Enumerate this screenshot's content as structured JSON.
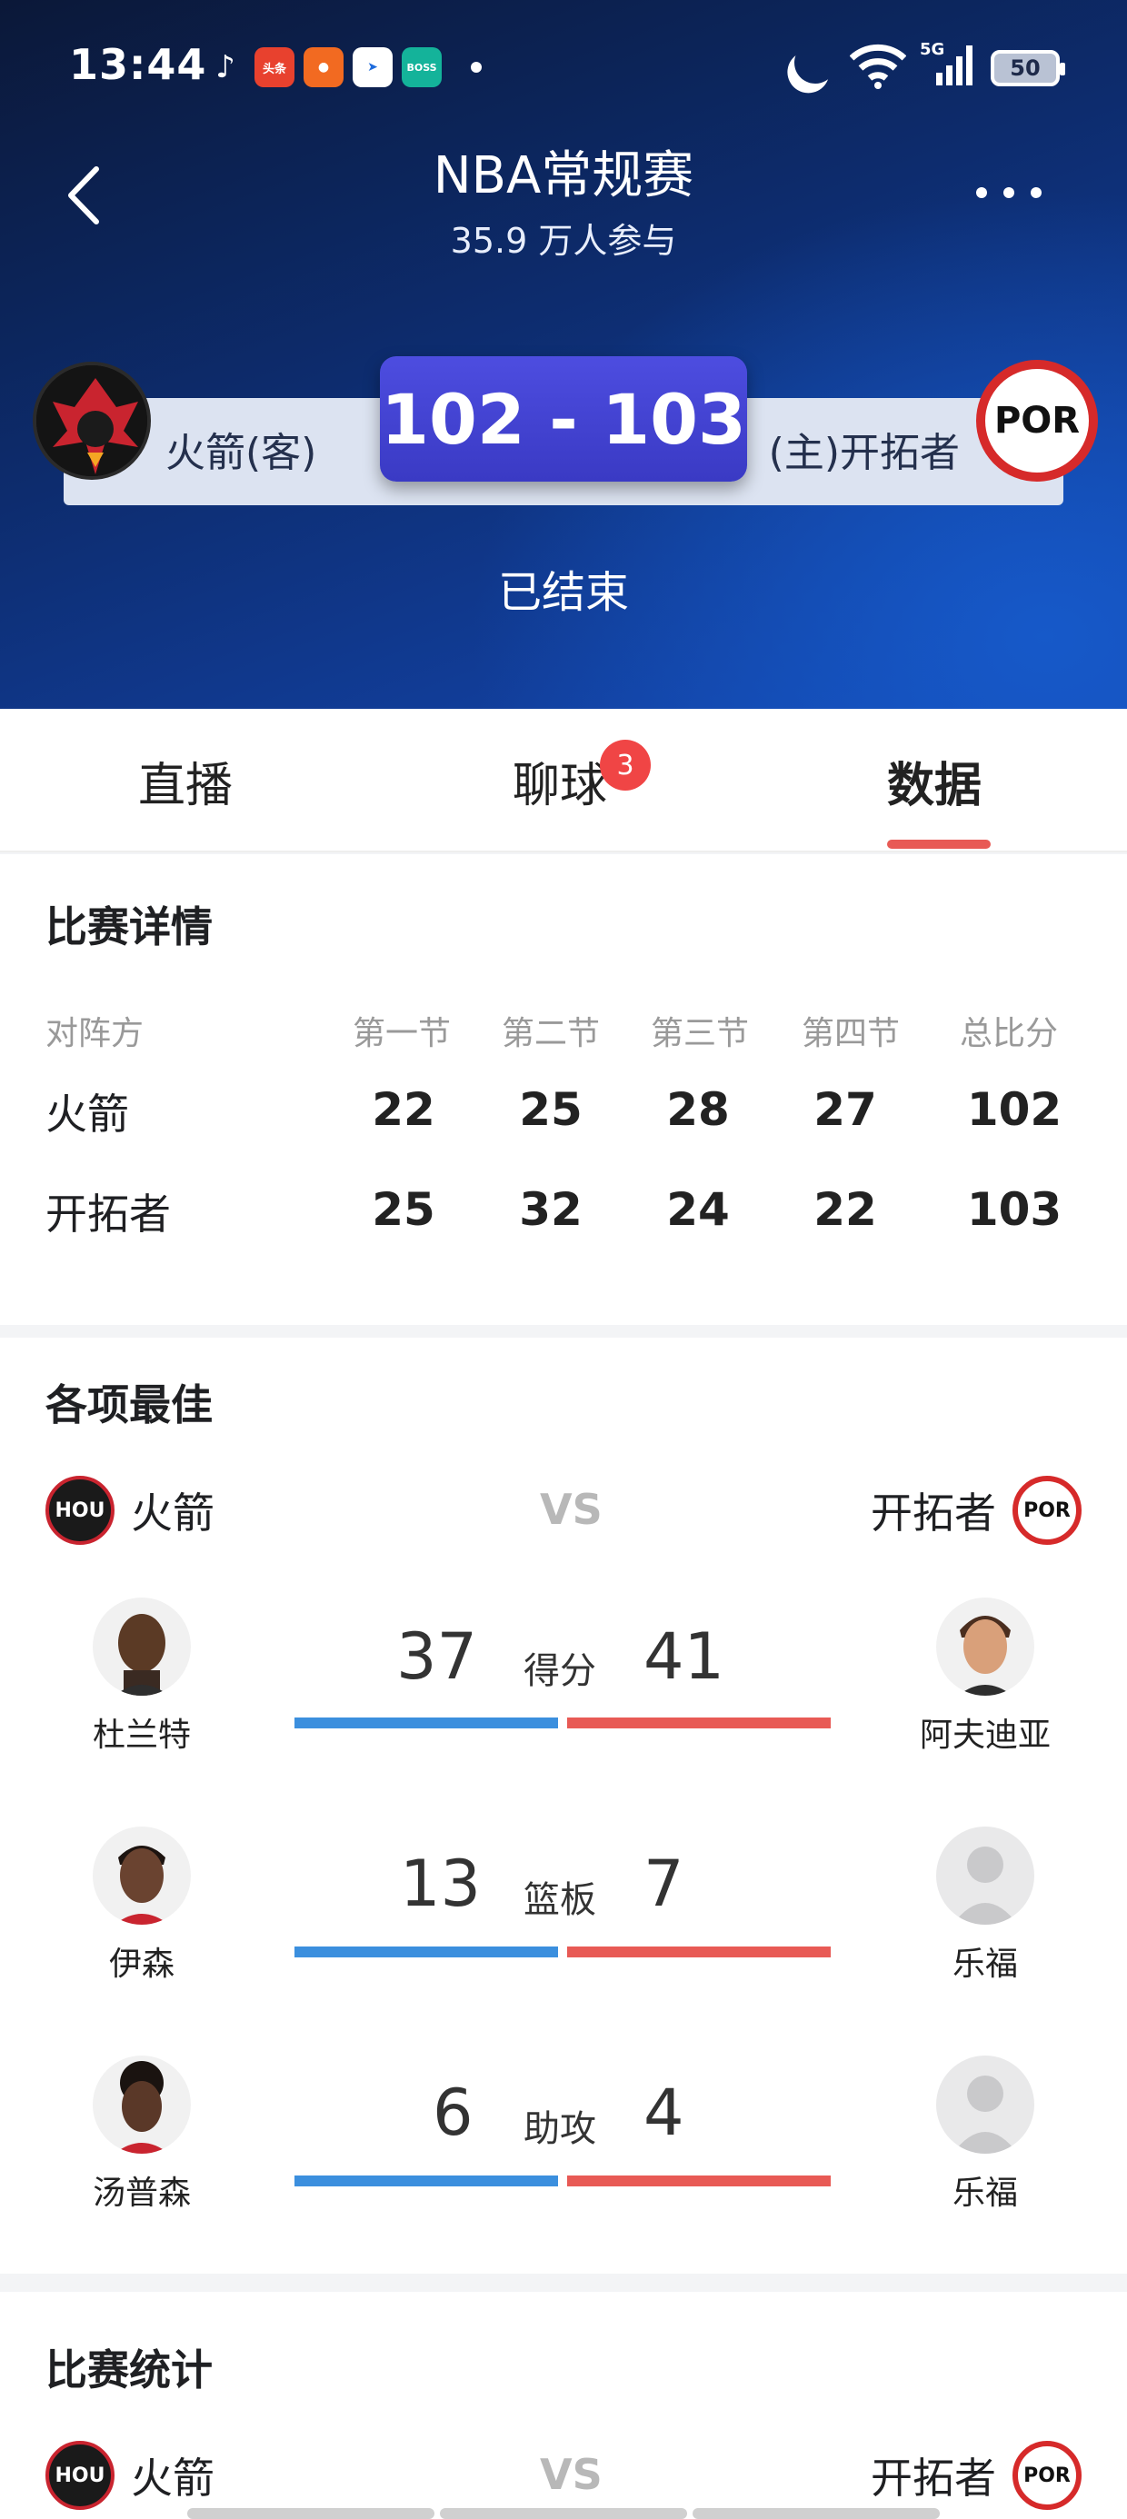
{
  "statusbar": {
    "time": "13:44",
    "apps": [
      "抖音",
      "头条",
      "拼多多",
      "浏览器",
      "BOSS直聘"
    ],
    "network": "5G",
    "battery": "50"
  },
  "header": {
    "title": "NBA常规赛",
    "participants": "35.9 万人参与",
    "away_team": "火箭(客)",
    "home_team": "(主)开拓者",
    "score": "102 - 103",
    "status": "已结束",
    "home_logo_text": "POR"
  },
  "tabs": [
    {
      "label": "直播"
    },
    {
      "label": "聊球",
      "badge": "3"
    },
    {
      "label": "数据",
      "active": true
    }
  ],
  "match_details": {
    "title": "比赛详情",
    "headers": [
      "对阵方",
      "第一节",
      "第二节",
      "第三节",
      "第四节",
      "总比分"
    ],
    "rows": [
      {
        "team": "火箭",
        "q": [
          "22",
          "25",
          "28",
          "27"
        ],
        "total": "102"
      },
      {
        "team": "开拓者",
        "q": [
          "25",
          "32",
          "24",
          "22"
        ],
        "total": "103"
      }
    ]
  },
  "leaders": {
    "title": "各项最佳",
    "away_team": "火箭",
    "home_team": "开拓者",
    "away_logo": "HOU",
    "home_logo": "POR",
    "vs": "VS",
    "stats": [
      {
        "label": "得分",
        "away_value": "37",
        "home_value": "41",
        "away_player": "杜兰特",
        "home_player": "阿夫迪亚"
      },
      {
        "label": "篮板",
        "away_value": "13",
        "home_value": "7",
        "away_player": "伊森",
        "home_player": "乐福"
      },
      {
        "label": "助攻",
        "away_value": "6",
        "home_value": "4",
        "away_player": "汤普森",
        "home_player": "乐福"
      }
    ]
  },
  "game_stats": {
    "title": "比赛统计",
    "away_team": "火箭",
    "home_team": "开拓者",
    "away_logo": "HOU",
    "home_logo": "POR",
    "vs": "VS"
  },
  "colors": {
    "away_bar": "#3b8fde",
    "home_bar": "#e85a55",
    "score_box": "#3a3ac4",
    "badge": "#f04545"
  }
}
